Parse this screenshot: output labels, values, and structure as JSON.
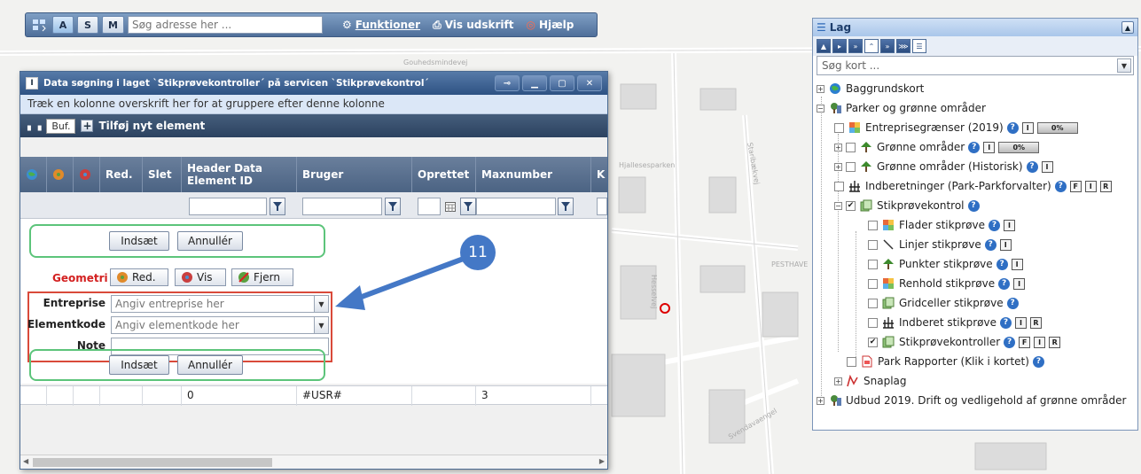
{
  "toolbar": {
    "btn_a": "A",
    "btn_s": "S",
    "btn_m": "M",
    "search_placeholder": "Søg adresse her ...",
    "funktioner": "Funktioner",
    "vis_udskrift": "Vis udskrift",
    "hjaelp": "Hjælp"
  },
  "map": {
    "street1": "Gouhedsmindevej",
    "street2": "Hjallesesparken",
    "street3": "Staribækvej",
    "street4": "PESTHAVE",
    "street5": "Svendavaengel",
    "street6": "Hesselvej"
  },
  "dialog": {
    "title_icon": "I",
    "title": "Data søgning i laget `Stikprøvekontroller´ på servicen `Stikprøvekontrol´",
    "group_hint": "Træk en kolonne overskrift her for at gruppere efter denne kolonne",
    "buf": "Buf.",
    "add_new": "Tilføj nyt element",
    "columns": {
      "red": "Red.",
      "slet": "Slet",
      "header_id": "Header Data Element ID",
      "bruger": "Bruger",
      "oprettet": "Oprettet",
      "maxnumber": "Maxnumber",
      "k": "K"
    },
    "insert": "Indsæt",
    "cancel": "Annullér",
    "geometri": "Geometri",
    "geo_red": "Red.",
    "geo_vis": "Vis",
    "geo_fjern": "Fjern",
    "entreprise_label": "Entreprise",
    "entreprise_placeholder": "Angiv entreprise her",
    "elementkode_label": "Elementkode",
    "elementkode_placeholder": "Angiv elementkode her",
    "note_label": "Note",
    "row": {
      "header_id": "0",
      "bruger": "#USR#",
      "maxnumber": "3"
    }
  },
  "callout": {
    "number": "11"
  },
  "lag": {
    "title": "Lag",
    "search_placeholder": "Søg kort ...",
    "nodes": [
      {
        "label": "Baggrundskort"
      },
      {
        "label": "Parker og grønne områder"
      },
      {
        "label": "Entreprisegrænser (2019)",
        "pct": "0%"
      },
      {
        "label": "Grønne områder",
        "pct": "0%"
      },
      {
        "label": "Grønne områder (Historisk)"
      },
      {
        "label": "Indberetninger (Park-Parkforvalter)"
      },
      {
        "label": "Stikprøvekontrol"
      },
      {
        "label": "Flader stikprøve"
      },
      {
        "label": "Linjer stikprøve"
      },
      {
        "label": "Punkter stikprøve"
      },
      {
        "label": "Renhold stikprøve"
      },
      {
        "label": "Gridceller stikprøve"
      },
      {
        "label": "Indberet stikprøve"
      },
      {
        "label": "Stikprøvekontroller"
      },
      {
        "label": "Park Rapporter (Klik i kortet)"
      },
      {
        "label": "Snaplag"
      },
      {
        "label": "Udbud 2019. Drift og vedligehold af grønne områder"
      }
    ],
    "box_i": "I",
    "box_f": "F",
    "box_r": "R"
  },
  "colors": {
    "title_bar": "#2e5283",
    "callout": "#4478c6",
    "highlight_green": "#5cc47a",
    "highlight_red": "#d94a3a"
  }
}
